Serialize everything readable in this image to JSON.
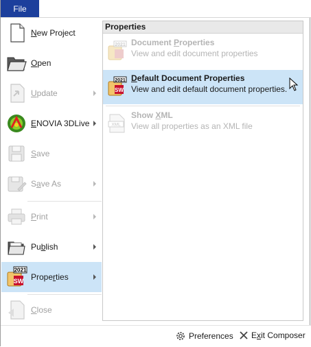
{
  "file_tab": "File",
  "menu": {
    "items": [
      {
        "label_pre": "",
        "label_key": "N",
        "label_post": "ew Project",
        "icon": "new-project-icon",
        "disabled": false
      },
      {
        "label_pre": "",
        "label_key": "O",
        "label_post": "pen",
        "icon": "open-folder-icon",
        "disabled": false
      },
      {
        "label_pre": "",
        "label_key": "U",
        "label_post": "pdate",
        "icon": "update-icon",
        "disabled": true
      },
      {
        "label_pre": "",
        "label_key": "E",
        "label_post": "NOVIA 3DLive",
        "icon": "enovia-3dlive-icon",
        "disabled": false
      },
      {
        "label_pre": "",
        "label_key": "S",
        "label_post": "ave",
        "icon": "save-icon",
        "disabled": true
      },
      {
        "label_pre": "S",
        "label_key": "a",
        "label_post": "ve As",
        "icon": "save-as-icon",
        "disabled": true
      },
      {
        "label_pre": "",
        "label_key": "P",
        "label_post": "rint",
        "icon": "print-icon",
        "disabled": true
      },
      {
        "label_pre": "Pu",
        "label_key": "b",
        "label_post": "lish",
        "icon": "publish-folder-icon",
        "disabled": false
      },
      {
        "label_pre": "Prope",
        "label_key": "r",
        "label_post": "ties",
        "icon": "properties-icon",
        "disabled": false,
        "selected": true
      },
      {
        "label_pre": "",
        "label_key": "C",
        "label_post": "lose",
        "icon": "close-icon",
        "disabled": true
      }
    ]
  },
  "properties_panel": {
    "header": "Properties",
    "items": [
      {
        "title_pre": "Document ",
        "title_key": "P",
        "title_post": "roperties",
        "desc": "View and edit document properties",
        "icon": "document-properties-icon",
        "disabled": true
      },
      {
        "title_pre": "",
        "title_key": "D",
        "title_post": "efault Document Properties",
        "desc": "View and edit default document properties.",
        "icon": "default-document-properties-icon",
        "disabled": false,
        "selected": true
      },
      {
        "title_pre": "Show ",
        "title_key": "X",
        "title_post": "ML",
        "desc": "View all properties as an XML file",
        "icon": "show-xml-icon",
        "disabled": true
      }
    ],
    "badge_year": "2021",
    "xml_badge": "XML"
  },
  "bottom": {
    "preferences": "Preferences",
    "exit_pre": "E",
    "exit_key": "x",
    "exit_post": "it Composer"
  },
  "colors": {
    "accent": "#1c3f9c",
    "selection": "#cce4f7",
    "disabled_text": "#a0a0a0"
  }
}
